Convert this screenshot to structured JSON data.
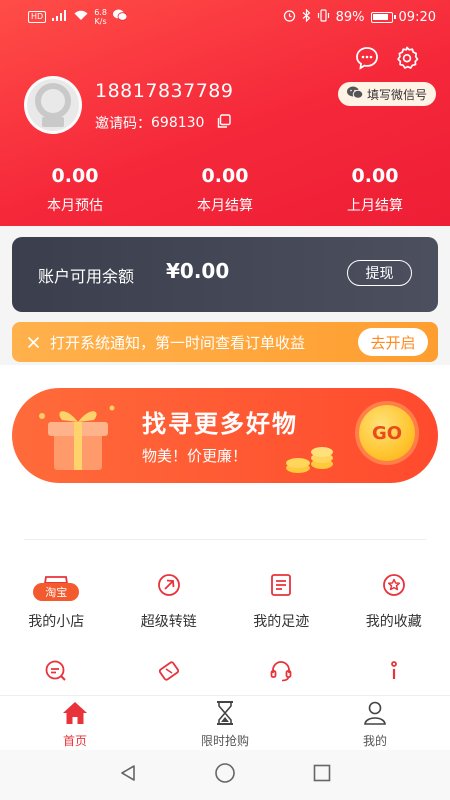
{
  "status_bar": {
    "hd": "HD",
    "net_speed_value": "6.8",
    "net_speed_unit": "K/s",
    "battery": "89%",
    "time": "09:20"
  },
  "profile": {
    "phone": "18817837789",
    "invite_label": "邀请码：",
    "invite_code": "698130",
    "wechat_button": "填写微信号"
  },
  "stats": [
    {
      "value": "0.00",
      "label": "本月预估"
    },
    {
      "value": "0.00",
      "label": "本月结算"
    },
    {
      "value": "0.00",
      "label": "上月结算"
    }
  ],
  "balance": {
    "label": "账户可用余额",
    "value": "¥0.00",
    "withdraw": "提现"
  },
  "notice": {
    "text": "打开系统通知，第一时间查看订单收益",
    "button": "去开启"
  },
  "banner": {
    "title": "找寻更多好物",
    "subtitle": "物美！价更廉！",
    "go": "GO"
  },
  "grid_row1": [
    {
      "label": "我的小店",
      "icon": "shop-icon",
      "tag": "淘宝"
    },
    {
      "label": "超级转链",
      "icon": "link-convert-icon"
    },
    {
      "label": "我的足迹",
      "icon": "footprint-icon"
    },
    {
      "label": "我的收藏",
      "icon": "favorite-star-icon"
    }
  ],
  "grid_row2": [
    {
      "icon": "chat-search-icon"
    },
    {
      "icon": "coupon-tag-icon"
    },
    {
      "icon": "headset-icon"
    },
    {
      "icon": "info-icon"
    }
  ],
  "tabs": [
    {
      "label": "首页",
      "icon": "home-icon",
      "active": true
    },
    {
      "label": "限时抢购",
      "icon": "hourglass-icon"
    },
    {
      "label": "我的",
      "icon": "user-icon"
    }
  ],
  "colors": {
    "brand_red": "#f5283a",
    "notice_orange": "#ff9e30",
    "balance_dark": "#3b3f4d",
    "icon_red": "#e8333a"
  }
}
